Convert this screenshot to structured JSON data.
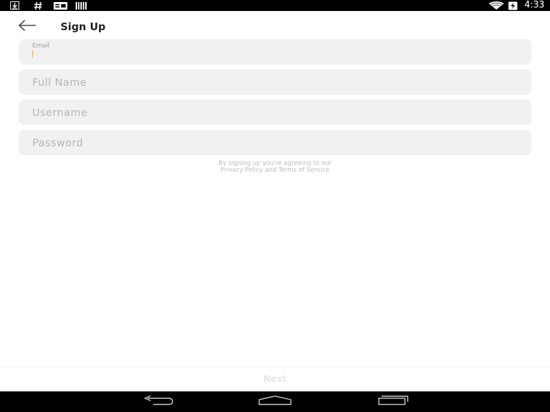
{
  "status_bar": {
    "time": "4:33",
    "left_icons": [
      "download-icon",
      "hashtag-icon",
      "message-icon",
      "barcode-icon"
    ],
    "right_icons": [
      "wifi-icon",
      "battery-charging-icon"
    ]
  },
  "header": {
    "title": "Sign Up",
    "back_icon": "arrow-left-icon"
  },
  "form": {
    "email": {
      "label": "Email",
      "value": "",
      "placeholder": ""
    },
    "full_name": {
      "placeholder": "Full Name",
      "value": ""
    },
    "username": {
      "placeholder": "Username",
      "value": ""
    },
    "password": {
      "placeholder": "Password",
      "value": ""
    }
  },
  "terms": {
    "line1": "By signing up you're agreeing to our",
    "line2": "Privacy Policy and Terms of Service"
  },
  "footer": {
    "next_label": "Next"
  },
  "nav_bar": {
    "icons": [
      "back-nav-icon",
      "home-nav-icon",
      "recents-nav-icon"
    ]
  },
  "colors": {
    "field_background": "#f1f1f1",
    "cursor_accent": "#f2b400",
    "placeholder": "#b5b5b5",
    "next_disabled": "#e6e6e6"
  }
}
